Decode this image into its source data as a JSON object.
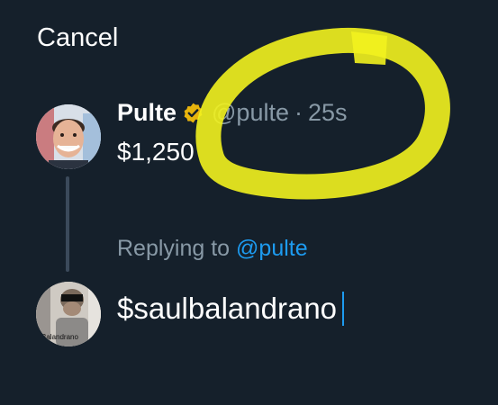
{
  "header": {
    "cancel_label": "Cancel"
  },
  "original_tweet": {
    "name": "Pulte",
    "verified_icon": "verified-badge-icon",
    "handle": "@pulte",
    "separator": "·",
    "time": "25s",
    "text": "$1,250"
  },
  "reply": {
    "replying_prefix": "Replying to",
    "replying_to": "@pulte",
    "draft_text": "$saulbalandrano",
    "avatar_caption": "Balandrano"
  },
  "colors": {
    "background": "#15202b",
    "secondary_text": "#8899a6",
    "link": "#1d9bf0",
    "highlight": "#f2f21e"
  }
}
